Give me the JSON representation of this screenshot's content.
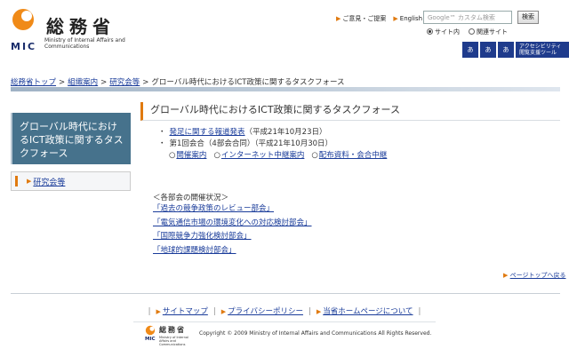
{
  "header": {
    "logo_kanji": "総務省",
    "logo_mic": "MIC",
    "logo_sub": "Ministry of Internal Affairs and Communications",
    "links": [
      {
        "label": "ご意見・ご提案"
      },
      {
        "label": "English"
      }
    ],
    "search_placeholder": "Google™ カスタム検索",
    "search_button": "検索",
    "radio_options": [
      {
        "label": "サイト内",
        "selected": true
      },
      {
        "label": "関連サイト",
        "selected": false
      }
    ],
    "access_badges": [
      "あ",
      "あ",
      "あ"
    ],
    "access_tool_label_1": "アクセシビリティ",
    "access_tool_label_2": "閲覧支援ツール"
  },
  "breadcrumb": {
    "items": [
      "総務省トップ",
      "組織案内",
      "研究会等"
    ],
    "current": "グローバル時代におけるICT政策に関するタスクフォース",
    "separator": ">"
  },
  "sidebar": {
    "title": "グローバル時代におけるICT政策に関するタスクフォース",
    "nav_item": "研究会等"
  },
  "main": {
    "title": "グローバル時代におけるICT政策に関するタスクフォース",
    "news_1_link": "発足に関する報道発表",
    "news_1_date": "（平成21年10月23日）",
    "news_2_text": "第1回会合（4部会合同）（平成21年10月30日）",
    "news_2_links": [
      "開催案内",
      "インターネット中継案内",
      "配布資料・会合中継"
    ],
    "bullet": "・",
    "ring": "○",
    "status_head": "＜各部会の開催状況＞",
    "subgroups": [
      "「過去の競争政策のレビュー部会」",
      "「電気通信市場の環境変化への対応検討部会」",
      "「国際競争力強化検討部会」",
      "「地球的課題検討部会」"
    ],
    "page_top": "ページトップへ戻る"
  },
  "footer": {
    "links": [
      "サイトマップ",
      "プライバシーポリシー",
      "当省ホームページについて"
    ],
    "logo_kanji": "総務省",
    "logo_mic": "MIC",
    "logo_sub": "Ministry of Internal Affairs and Communications",
    "copyright": "Copyright © 2009 Ministry of Internal Affairs and Communications All Rights Reserved."
  },
  "colors": {
    "accent_orange": "#e07a10",
    "link_blue": "#1a3c9a",
    "sidebar_teal": "#46728c",
    "badge_navy": "#1f3b8c"
  }
}
